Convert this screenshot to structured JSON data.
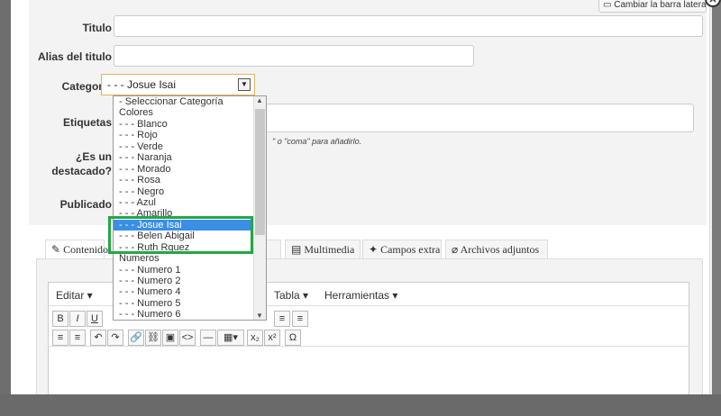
{
  "form": {
    "sidebar_toggle": "Cambiar la barra lateral",
    "titulo_label": "Titulo",
    "alias_label": "Alias del titulo",
    "categoria_label": "Categoría",
    "categoria_value": "- - - Josue Isai",
    "etiquetas_label": "Etiquetas",
    "etiquetas_hint": "\" o \"coma\" para añadirlo.",
    "destacado_label_1": "¿Es un",
    "destacado_label_2": "destacado?",
    "publicado_label": "Publicado"
  },
  "dropdown": {
    "options": [
      "- Seleccionar Categoría",
      "Colores",
      "- - - Blanco",
      "- - - Rojo",
      "- - - Verde",
      "- - - Naranja",
      "- - - Morado",
      "- - - Rosa",
      "- - - Negro",
      "- - - Azul",
      "- - - Amarillo",
      "- - - Josue Isai",
      "- - - Belen Abigail",
      "- - - Ruth Rguez",
      "Numeros",
      "- - - Numero 1",
      "- - - Numero 2",
      "- - - Numero 4",
      "- - - Numero 5",
      "- - - Numero 6"
    ],
    "selected_index": 11
  },
  "tabs": [
    {
      "label": "Contenido",
      "icon": "edit-icon"
    },
    {
      "label": "nes",
      "icon": ""
    },
    {
      "label": "Multimedia",
      "icon": "film-icon"
    },
    {
      "label": "Campos extra",
      "icon": "puzzle-icon"
    },
    {
      "label": "Archivos adjuntos",
      "icon": "paperclip-icon"
    }
  ],
  "editor": {
    "menus": [
      "Editar ▾",
      "Tabla ▾",
      "Herramientas ▾"
    ],
    "row1": [
      "B",
      "I",
      "U",
      "≡",
      "≡"
    ],
    "row2": [
      "≡",
      "≡",
      "↶",
      "↷",
      "🔗",
      "⛓",
      "▣",
      "<>",
      "—",
      "▦▾",
      "x₂",
      "x²",
      "Ω"
    ]
  },
  "colors": {
    "selected_option": "#3a8ee6",
    "highlight_border": "#22a745",
    "select_border": "#e5b45a"
  }
}
